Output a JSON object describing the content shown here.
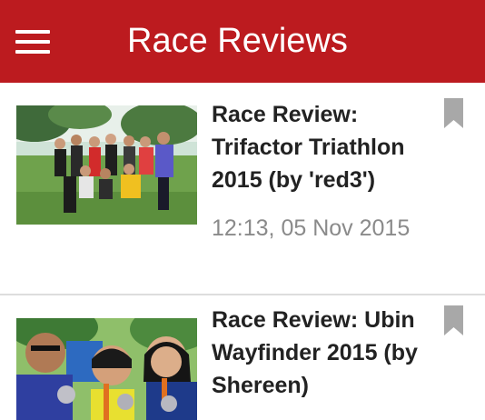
{
  "app_bar": {
    "title": "Race Reviews",
    "menu_icon": "hamburger-menu-icon",
    "background_color": "#bc1b1f"
  },
  "articles": [
    {
      "title": "Race Review: Trifactor Triathlon 2015 (by 'red3')",
      "timestamp": "12:13, 05 Nov 2015",
      "thumbnail": "group-of-triathletes-photo",
      "bookmark_icon": "bookmark-icon"
    },
    {
      "title": "Race Review: Ubin Wayfinder 2015 (by Shereen)",
      "thumbnail": "three-runners-with-medals-photo",
      "bookmark_icon": "bookmark-icon"
    }
  ]
}
